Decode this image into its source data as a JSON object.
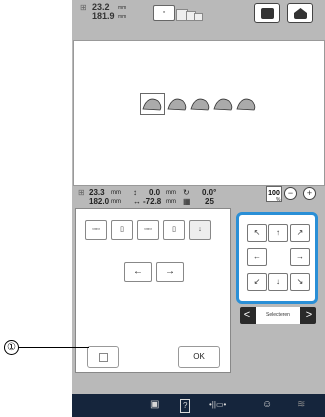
{
  "header": {
    "size_w": "23.2",
    "size_h": "181.9",
    "unit": "mm",
    "frame_label": "▫"
  },
  "status": {
    "w": "23.3",
    "h": "182.0",
    "unit": "mm",
    "x": "0.0",
    "y": "-72.8",
    "xy_unit": "mm",
    "angle": "0.0°",
    "thread_count": "25"
  },
  "zoom": {
    "value": "100",
    "unit": "%"
  },
  "tools": {
    "row_labels": [
      "▫▫▫",
      "▯",
      "▫▫▫",
      "▯",
      "↓"
    ],
    "left_arrow": "←",
    "right_arrow": "→"
  },
  "nav_pad": {
    "up_left": "↖",
    "up": "↑",
    "up_right": "↗",
    "left": "←",
    "right": "→",
    "down_left": "↙",
    "down": "↓",
    "down_right": "↘"
  },
  "selector": {
    "prev": "<",
    "label": "Selecteren",
    "next": ">"
  },
  "ok_label": "OK",
  "callout": {
    "number": "①"
  },
  "bottom_icons": [
    "▣",
    "?",
    "•||▭•",
    "☺",
    "≋"
  ]
}
